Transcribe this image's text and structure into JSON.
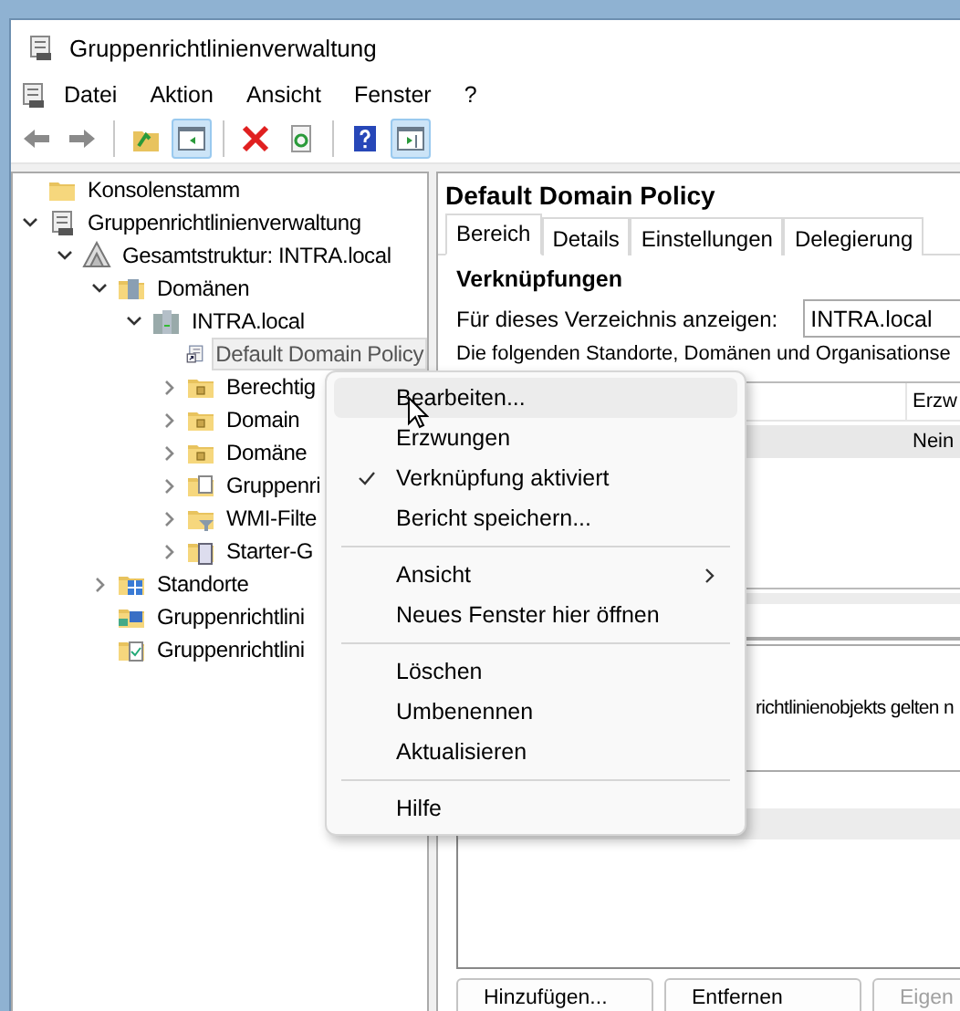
{
  "window": {
    "title": "Gruppenrichtlinienverwaltung"
  },
  "menu_bar": [
    "Datei",
    "Aktion",
    "Ansicht",
    "Fenster",
    "?"
  ],
  "toolbar": [
    {
      "kind": "back",
      "disabled": false,
      "pressed": false
    },
    {
      "kind": "forward",
      "disabled": false,
      "pressed": false
    },
    {
      "kind": "separator"
    },
    {
      "kind": "up",
      "disabled": false,
      "pressed": false
    },
    {
      "kind": "tree-toggle",
      "disabled": false,
      "pressed": true
    },
    {
      "kind": "separator"
    },
    {
      "kind": "delete",
      "disabled": false,
      "pressed": false
    },
    {
      "kind": "refresh",
      "disabled": false,
      "pressed": false
    },
    {
      "kind": "separator"
    },
    {
      "kind": "help",
      "disabled": false,
      "pressed": false
    },
    {
      "kind": "pane-toggle",
      "disabled": false,
      "pressed": true
    }
  ],
  "tree": [
    {
      "label": "Konsolenstamm",
      "kind": "folder",
      "selected": false
    },
    {
      "label": "Gruppenrichtlinienverwaltung",
      "kind": "console",
      "expanded": true,
      "selected": false,
      "children": [
        {
          "label": "Gesamtstruktur: INTRA.local",
          "kind": "forest",
          "expanded": true,
          "selected": false,
          "children": [
            {
              "label": "Domänen",
              "kind": "domains",
              "expanded": true,
              "selected": false,
              "children": [
                {
                  "label": "INTRA.local",
                  "kind": "domain",
                  "expanded": true,
                  "selected": false,
                  "children": [
                    {
                      "label": "Default Domain Policy",
                      "kind": "link",
                      "selected": true
                    },
                    {
                      "label": "Berechtig",
                      "kind": "ou",
                      "expanded": false,
                      "selected": false
                    },
                    {
                      "label": "Domain",
                      "kind": "ou",
                      "expanded": false,
                      "selected": false
                    },
                    {
                      "label": "Domäne",
                      "kind": "ou",
                      "expanded": false,
                      "selected": false
                    },
                    {
                      "label": "Gruppenri",
                      "kind": "gpo-folder",
                      "expanded": false,
                      "selected": false
                    },
                    {
                      "label": "WMI-Filte",
                      "kind": "filter-folder",
                      "expanded": false,
                      "selected": false
                    },
                    {
                      "label": "Starter-G",
                      "kind": "starter-folder",
                      "expanded": false,
                      "selected": false
                    }
                  ]
                }
              ]
            },
            {
              "label": "Standorte",
              "kind": "sites",
              "expanded": false,
              "selected": false
            },
            {
              "label": "Gruppenrichtlini",
              "kind": "modeling",
              "selected": false
            },
            {
              "label": "Gruppenrichtlini",
              "kind": "results",
              "selected": false
            }
          ]
        }
      ]
    }
  ],
  "details": {
    "title": "Default Domain Policy",
    "tabs": [
      {
        "label": "Bereich",
        "selected": true
      },
      {
        "label": "Details",
        "selected": false
      },
      {
        "label": "Einstellungen",
        "selected": false
      },
      {
        "label": "Delegierung",
        "selected": false
      }
    ],
    "links_heading": "Verknüpfungen",
    "location_label": "Für dieses Verzeichnis anzeigen:",
    "location_value": "INTRA.local",
    "links_note": "Die folgenden Standorte, Domänen und Organisationse",
    "links_table": {
      "columns": [
        "Erzw"
      ],
      "rows": [
        {
          "cells": [
            "Nein"
          ],
          "selected": true
        }
      ]
    },
    "filter_note": "richtlinienobjekts gelten n",
    "buttons": [
      {
        "label": "Hinzufügen...",
        "disabled": false
      },
      {
        "label": "Entfernen",
        "disabled": false
      },
      {
        "label": "Eigen",
        "disabled": true
      }
    ]
  },
  "context_menu": [
    {
      "kind": "item",
      "label": "Bearbeiten...",
      "checked": false,
      "submenu": false,
      "selected": true
    },
    {
      "kind": "item",
      "label": "Erzwungen",
      "checked": false,
      "submenu": false,
      "selected": false
    },
    {
      "kind": "item",
      "label": "Verknüpfung aktiviert",
      "checked": true,
      "submenu": false,
      "selected": false
    },
    {
      "kind": "item",
      "label": "Bericht speichern...",
      "checked": false,
      "submenu": false,
      "selected": false
    },
    {
      "kind": "separator"
    },
    {
      "kind": "item",
      "label": "Ansicht",
      "checked": false,
      "submenu": true,
      "selected": false
    },
    {
      "kind": "item",
      "label": "Neues Fenster hier öffnen",
      "checked": false,
      "submenu": false,
      "selected": false
    },
    {
      "kind": "separator"
    },
    {
      "kind": "item",
      "label": "Löschen",
      "checked": false,
      "submenu": false,
      "selected": false
    },
    {
      "kind": "item",
      "label": "Umbenennen",
      "checked": false,
      "submenu": false,
      "selected": false
    },
    {
      "kind": "item",
      "label": "Aktualisieren",
      "checked": false,
      "submenu": false,
      "selected": false
    },
    {
      "kind": "separator"
    },
    {
      "kind": "item",
      "label": "Hilfe",
      "checked": false,
      "submenu": false,
      "selected": false
    }
  ]
}
